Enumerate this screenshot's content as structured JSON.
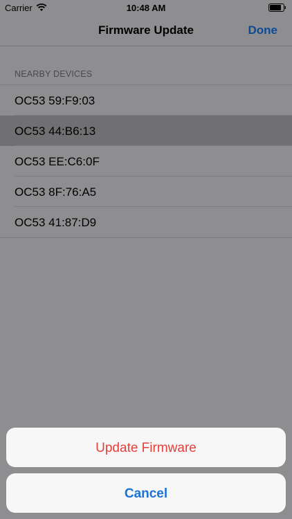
{
  "status_bar": {
    "carrier": "Carrier",
    "time": "10:48 AM",
    "wifi_icon": "wifi-icon",
    "battery_icon": "battery-icon"
  },
  "nav": {
    "title": "Firmware Update",
    "done_label": "Done"
  },
  "section": {
    "header": "NEARBY DEVICES"
  },
  "devices": [
    {
      "label": "OC53 59:F9:03",
      "selected": false
    },
    {
      "label": "OC53 44:B6:13",
      "selected": true
    },
    {
      "label": "OC53 EE:C6:0F",
      "selected": false
    },
    {
      "label": "OC53 8F:76:A5",
      "selected": false
    },
    {
      "label": "OC53 41:87:D9",
      "selected": false
    }
  ],
  "action_sheet": {
    "update_label": "Update Firmware",
    "cancel_label": "Cancel"
  },
  "colors": {
    "destructive": "#e2403b",
    "action_blue": "#1a73d6",
    "nav_blue": "#0c4a93",
    "dim_background": "#8e8e91"
  }
}
